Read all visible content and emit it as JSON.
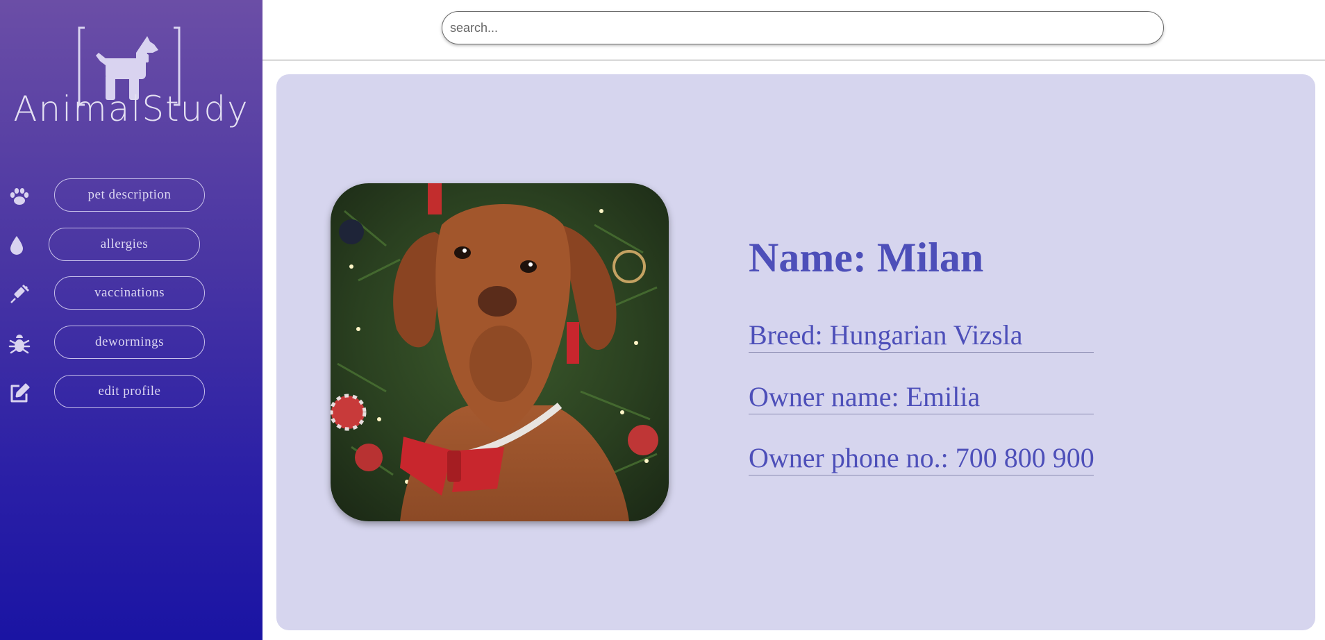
{
  "app": {
    "name": "AnimalStudy"
  },
  "colors": {
    "accent": "#4d4fb9",
    "sidebar_top": "#6b4ea6",
    "sidebar_bottom": "#1a14a3",
    "card_bg": "#d6d5ee"
  },
  "sidebar": {
    "items": [
      {
        "label": "pet description",
        "icon": "paw-icon"
      },
      {
        "label": "allergies",
        "icon": "droplet-icon"
      },
      {
        "label": "vaccinations",
        "icon": "syringe-icon"
      },
      {
        "label": "dewormings",
        "icon": "bug-icon"
      },
      {
        "label": "edit profile",
        "icon": "edit-icon"
      }
    ]
  },
  "search": {
    "placeholder": "search..."
  },
  "pet": {
    "name": "Name: Milan",
    "breed": "Breed: Hungarian Vizsla",
    "owner_name": "Owner name: Emilia",
    "owner_phone": "Owner phone no.: 700 800 900",
    "photo_icon": "dog-photo"
  }
}
